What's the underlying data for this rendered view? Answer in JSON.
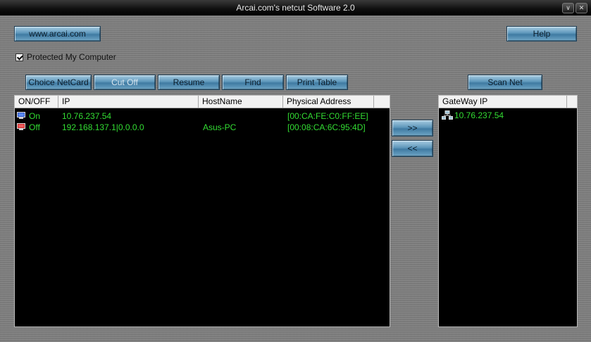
{
  "window": {
    "title": "Arcai.com's netcut Software 2.0"
  },
  "toolbar": {
    "website_label": "www.arcai.com",
    "help_label": "Help",
    "protect_label": "Protected My Computer",
    "choice_netcard_label": "Choice NetCard",
    "cut_off_label": "Cut Off",
    "resume_label": "Resume",
    "find_label": "Find",
    "print_table_label": "Print Table",
    "scan_net_label": "Scan Net",
    "move_right_label": ">>",
    "move_left_label": "<<"
  },
  "table": {
    "columns": [
      "ON/OFF",
      "IP",
      "HostName",
      "Physical Address"
    ],
    "rows": [
      {
        "status": "On",
        "ip": "10.76.237.54",
        "host": "",
        "mac": "[00:CA:FE:C0:FF:EE]"
      },
      {
        "status": "Off",
        "ip": "192.168.137.1|0.0.0.0",
        "host": "Asus-PC",
        "mac": "[00:08:CA:6C:95:4D]"
      }
    ]
  },
  "gateway": {
    "column": "GateWay IP",
    "items": [
      "10.76.237.54"
    ]
  },
  "colors": {
    "text_green": "#33dd33",
    "button_blue": "#5e97bb",
    "on_icon": "blue-monitor-icon",
    "off_icon": "red-monitor-icon"
  }
}
